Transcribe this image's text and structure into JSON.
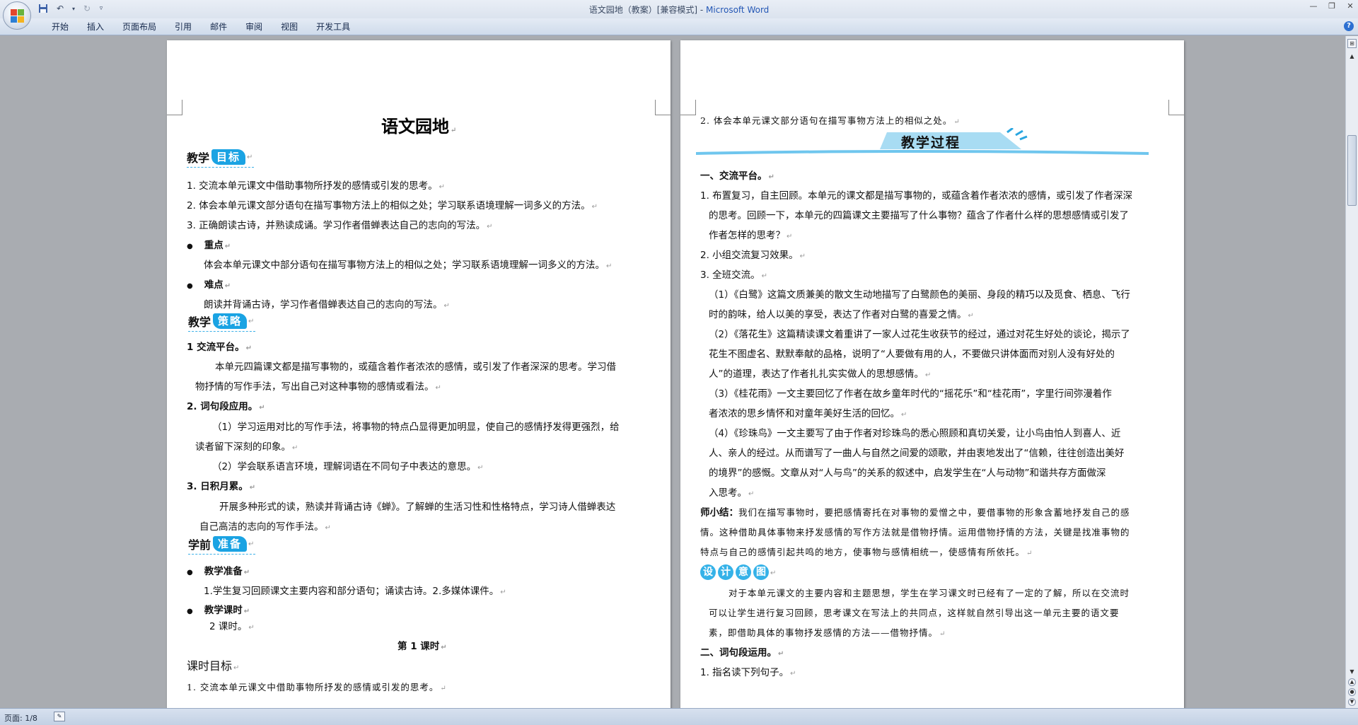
{
  "window": {
    "title": "语文园地（教案）[兼容模式] - ",
    "app_name": "Microsoft Word"
  },
  "ribbon": {
    "tabs": [
      "开始",
      "插入",
      "页面布局",
      "引用",
      "邮件",
      "审阅",
      "视图",
      "开发工具"
    ]
  },
  "status": {
    "page": "页面: 1/8"
  },
  "left_page": {
    "title": "语文园地",
    "sections": {
      "goal": {
        "a": "教学",
        "b": "目标"
      },
      "strategy": {
        "a": "教学",
        "b": "策略"
      },
      "prep": {
        "a": "学前",
        "b": "准备"
      }
    },
    "goals": [
      "1. 交流本单元课文中借助事物所抒发的感情或引发的思考。",
      "2. 体会本单元课文部分语句在描写事物方法上的相似之处；学习联系语境理解一词多义的方法。",
      "3. 正确朗读古诗，并熟读成诵。学习作者借蝉表达自己的志向的写法。"
    ],
    "key_label": "重点",
    "key_text": "体会本单元课文中部分语句在描写事物方法上的相似之处；学习联系语境理解一词多义的方法。",
    "diff_label": "难点",
    "diff_text": "朗读并背诵古诗，学习作者借蝉表达自己的志向的写法。",
    "s1_head": "1 交流平台。",
    "s1_l1": "本单元四篇课文都是描写事物的，或蕴含着作者浓浓的感情，或引发了作者深深的思考。学习借",
    "s1_l2": "物抒情的写作手法，写出自己对这种事物的感情或看法。",
    "s2_head": "2. 词句段应用。",
    "s2_l1": "（1）学习运用对比的写作手法，将事物的特点凸显得更加明显，使自己的感情抒发得更强烈，给",
    "s2_l2": "读者留下深刻的印象。",
    "s2_l3": "（2）学会联系语言环境，理解词语在不同句子中表达的意思。",
    "s3_head": "3. 日积月累。",
    "s3_l1": "开展多种形式的读，熟读并背诵古诗《蝉》。了解蝉的生活习性和性格特点，学习诗人借蝉表达",
    "s3_l2": "自己高洁的志向的写作手法。",
    "prep_label": "教学准备",
    "prep_text": "1.学生复习回顾课文主要内容和部分语句；诵读古诗。2.多媒体课件。",
    "hours_label": "教学课时",
    "hours_text": "2 课时。",
    "lesson1": "第 1 课时",
    "lesson_goal": "课时目标",
    "lesson_goal_1": "1. 交流本单元课文中借助事物所抒发的感情或引发的思考。"
  },
  "right_page": {
    "top_line": "2. 体会本单元课文部分语句在描写事物方法上的相似之处。",
    "banner": "教学过程",
    "h1": "一、交流平台。",
    "p1_1": "1. 布置复习，自主回顾。本单元的课文都是描写事物的，或蕴含着作者浓浓的感情，或引发了作者深深",
    "p1_2": "的思考。回顾一下，本单元的四篇课文主要描写了什么事物？蕴含了作者什么样的思想感情或引发了",
    "p1_3": "作者怎样的思考？",
    "p2": "2. 小组交流复习效果。",
    "p3": "3. 全班交流。",
    "q1_1": "（1）《白鹭》这篇文质兼美的散文生动地描写了白鹭颜色的美丽、身段的精巧以及觅食、栖息、飞行",
    "q1_2": "时的韵味，给人以美的享受，表达了作者对白鹭的喜爱之情。",
    "q2_1": "（2）《落花生》这篇精读课文着重讲了一家人过花生收获节的经过，通过对花生好处的谈论，揭示了",
    "q2_2": "花生不图虚名、默默奉献的品格，说明了“人要做有用的人，不要做只讲体面而对别人没有好处的",
    "q2_3": "人”的道理，表达了作者扎扎实实做人的思想感情。",
    "q3_1": "（3）《桂花雨》一文主要回忆了作者在故乡童年时代的“摇花乐”和“桂花雨”，字里行间弥漫着作",
    "q3_2": "者浓浓的思乡情怀和对童年美好生活的回忆。",
    "q4_1": "（4）《珍珠鸟》一文主要写了由于作者对珍珠鸟的悉心照顾和真切关爱，让小鸟由怕人到喜人、近",
    "q4_2": "人、亲人的经过。从而谱写了一曲人与自然之间爱的颂歌，并由衷地发出了“信赖，往往创造出美好",
    "q4_3": "的境界”的感慨。文章从对“人与鸟”的关系的叙述中，启发学生在“人与动物”和谐共存方面做深",
    "q4_4": "入思考。",
    "summary_label": "师小结：",
    "summary_1": "我们在描写事物时，要把感情寄托在对事物的爱憎之中，要借事物的形象含蓄地抒发自己的感",
    "summary_2": "情。这种借助具体事物来抒发感情的写作方法就是借物抒情。运用借物抒情的方法，关键是找准事物的",
    "summary_3": "特点与自己的感情引起共鸣的地方，使事物与感情相统一，使感情有所依托。",
    "design": [
      "设",
      "计",
      "意",
      "图"
    ],
    "design_1": "对于本单元课文的主要内容和主题思想，学生在学习课文时已经有了一定的了解，所以在交流时",
    "design_2": "可以让学生进行复习回顾，思考课文在写法上的共同点，这样就自然引导出这一单元主要的语文要",
    "design_3": "素，即借助具体的事物抒发感情的方法——借物抒情。",
    "h2": "二、词句段运用。",
    "h2_1": "1. 指名读下列句子。"
  },
  "colors": {
    "accent": "#1aa3e3",
    "page": "#ffffff",
    "workspace": "#a9acb1"
  }
}
